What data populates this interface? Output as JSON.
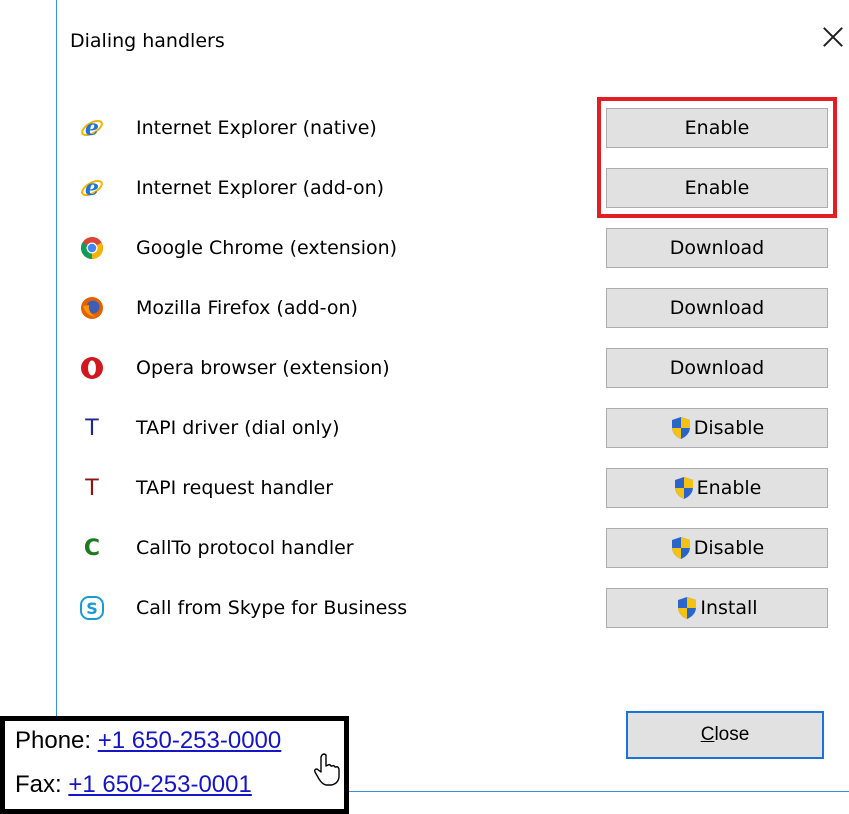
{
  "dialog": {
    "title": "Dialing handlers",
    "close_button_label": "Close"
  },
  "handlers": [
    {
      "icon": "internet-explorer-icon",
      "label": "Internet Explorer (native)",
      "button": "Enable",
      "shield": false
    },
    {
      "icon": "internet-explorer-icon",
      "label": "Internet Explorer (add-on)",
      "button": "Enable",
      "shield": false
    },
    {
      "icon": "google-chrome-icon",
      "label": "Google Chrome (extension)",
      "button": "Download",
      "shield": false
    },
    {
      "icon": "mozilla-firefox-icon",
      "label": "Mozilla Firefox (add-on)",
      "button": "Download",
      "shield": false
    },
    {
      "icon": "opera-icon",
      "label": "Opera browser (extension)",
      "button": "Download",
      "shield": false
    },
    {
      "icon": "tapi-driver-icon",
      "icon_text": "T",
      "label": "TAPI driver (dial only)",
      "button": "Disable",
      "shield": true
    },
    {
      "icon": "tapi-request-icon",
      "icon_text": "T",
      "label": "TAPI request handler",
      "button": "Enable",
      "shield": true
    },
    {
      "icon": "callto-icon",
      "icon_text": "C",
      "label": "CallTo protocol handler",
      "button": "Disable",
      "shield": true
    },
    {
      "icon": "skype-for-business-icon",
      "label": "Call from Skype for Business",
      "button": "Install",
      "shield": true
    }
  ],
  "contact": {
    "phone_label": "Phone:",
    "phone_number": "+1 650-253-0000",
    "fax_label": "Fax:",
    "fax_number": "+1 650-253-0001"
  },
  "colors": {
    "highlight": "#e01e24",
    "link": "#1515c8",
    "window_border": "#3a8ee6"
  }
}
